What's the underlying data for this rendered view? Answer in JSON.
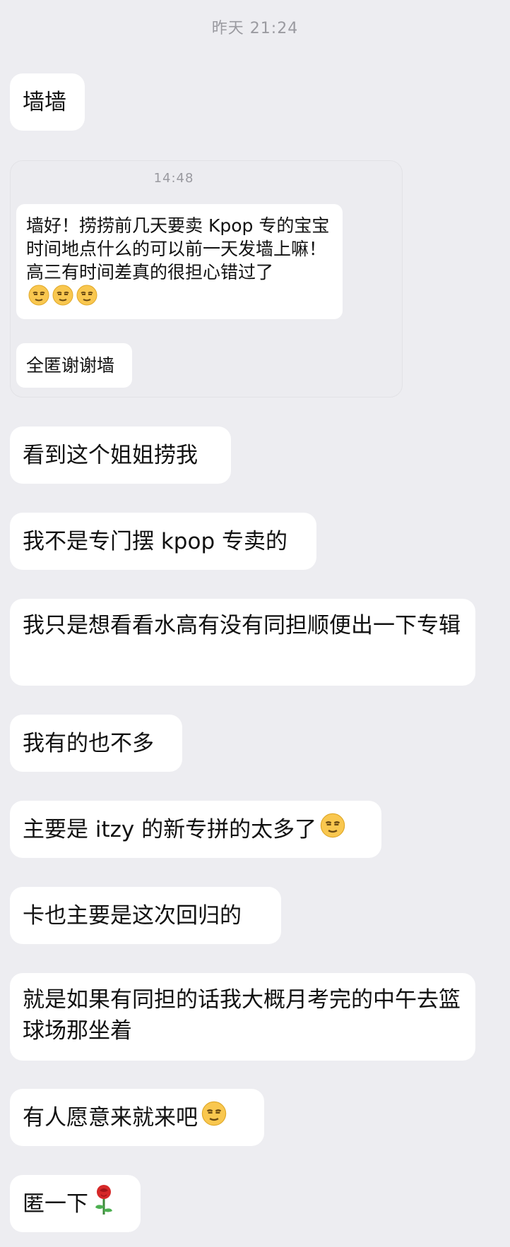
{
  "header": {
    "timestamp": "昨天 21:24"
  },
  "messages": [
    {
      "text": "墙墙"
    },
    {
      "quote": {
        "time": "14:48",
        "body": "墙好！捞捞前几天要卖 Kpop 专的宝宝时间地点什么的可以前一天发墙上嘛！高三有时间差真的很担心错过了",
        "emojis": [
          "smirk-face",
          "smirk-face",
          "smirk-face"
        ],
        "reply": "全匿谢谢墙"
      }
    },
    {
      "text": "看到这个姐姐捞我"
    },
    {
      "text": "我不是专门摆 kpop 专卖的"
    },
    {
      "text": "我只是想看看水高有没有同担顺便出一下专辑"
    },
    {
      "text": "我有的也不多"
    },
    {
      "text": "主要是 itzy 的新专拼的太多了",
      "emoji": "smirk-face"
    },
    {
      "text": "卡也主要是这次回归的"
    },
    {
      "text": "就是如果有同担的话我大概月考完的中午去篮球场那坐着"
    },
    {
      "text": "有人愿意来就来吧",
      "emoji": "smirk-face"
    },
    {
      "text": "匿一下",
      "emoji": "rose"
    }
  ],
  "colors": {
    "background": "#ededf1",
    "bubble": "#ffffff",
    "text": "#111111",
    "timestamp": "#9a9aa0",
    "emoji_face": "#f9c74f"
  }
}
